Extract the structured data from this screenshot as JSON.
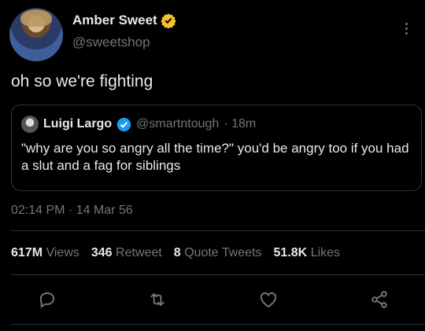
{
  "author": {
    "display_name": "Amber Sweet",
    "handle": "@sweetshop",
    "verified_badge_color": "#f5c12c"
  },
  "tweet": {
    "text": "oh so we're fighting"
  },
  "quoted_tweet": {
    "display_name": "Luigi Largo",
    "handle": "@smartntough",
    "time": "· 18m",
    "text": "\"why are you so angry all the time?\" you'd be angry too if you had a slut and a fag for siblings",
    "verified_badge_color": "#1d9bf0"
  },
  "meta": {
    "timestamp": "02:14 PM · 14 Mar 56"
  },
  "stats": {
    "views_value": "617M",
    "views_label": "Views",
    "retweets_value": "346",
    "retweets_label": "Retweet",
    "quotes_value": "8",
    "quotes_label": "Quote Tweets",
    "likes_value": "51.8K",
    "likes_label": "Likes"
  },
  "actions": {
    "reply_icon": "reply-icon",
    "retweet_icon": "retweet-icon",
    "like_icon": "like-icon",
    "share_icon": "share-icon"
  },
  "colors": {
    "background": "#000000",
    "text": "#e7e9ea",
    "secondary": "#71767b",
    "divider": "#2f3336",
    "accent": "#1d9bf0"
  }
}
